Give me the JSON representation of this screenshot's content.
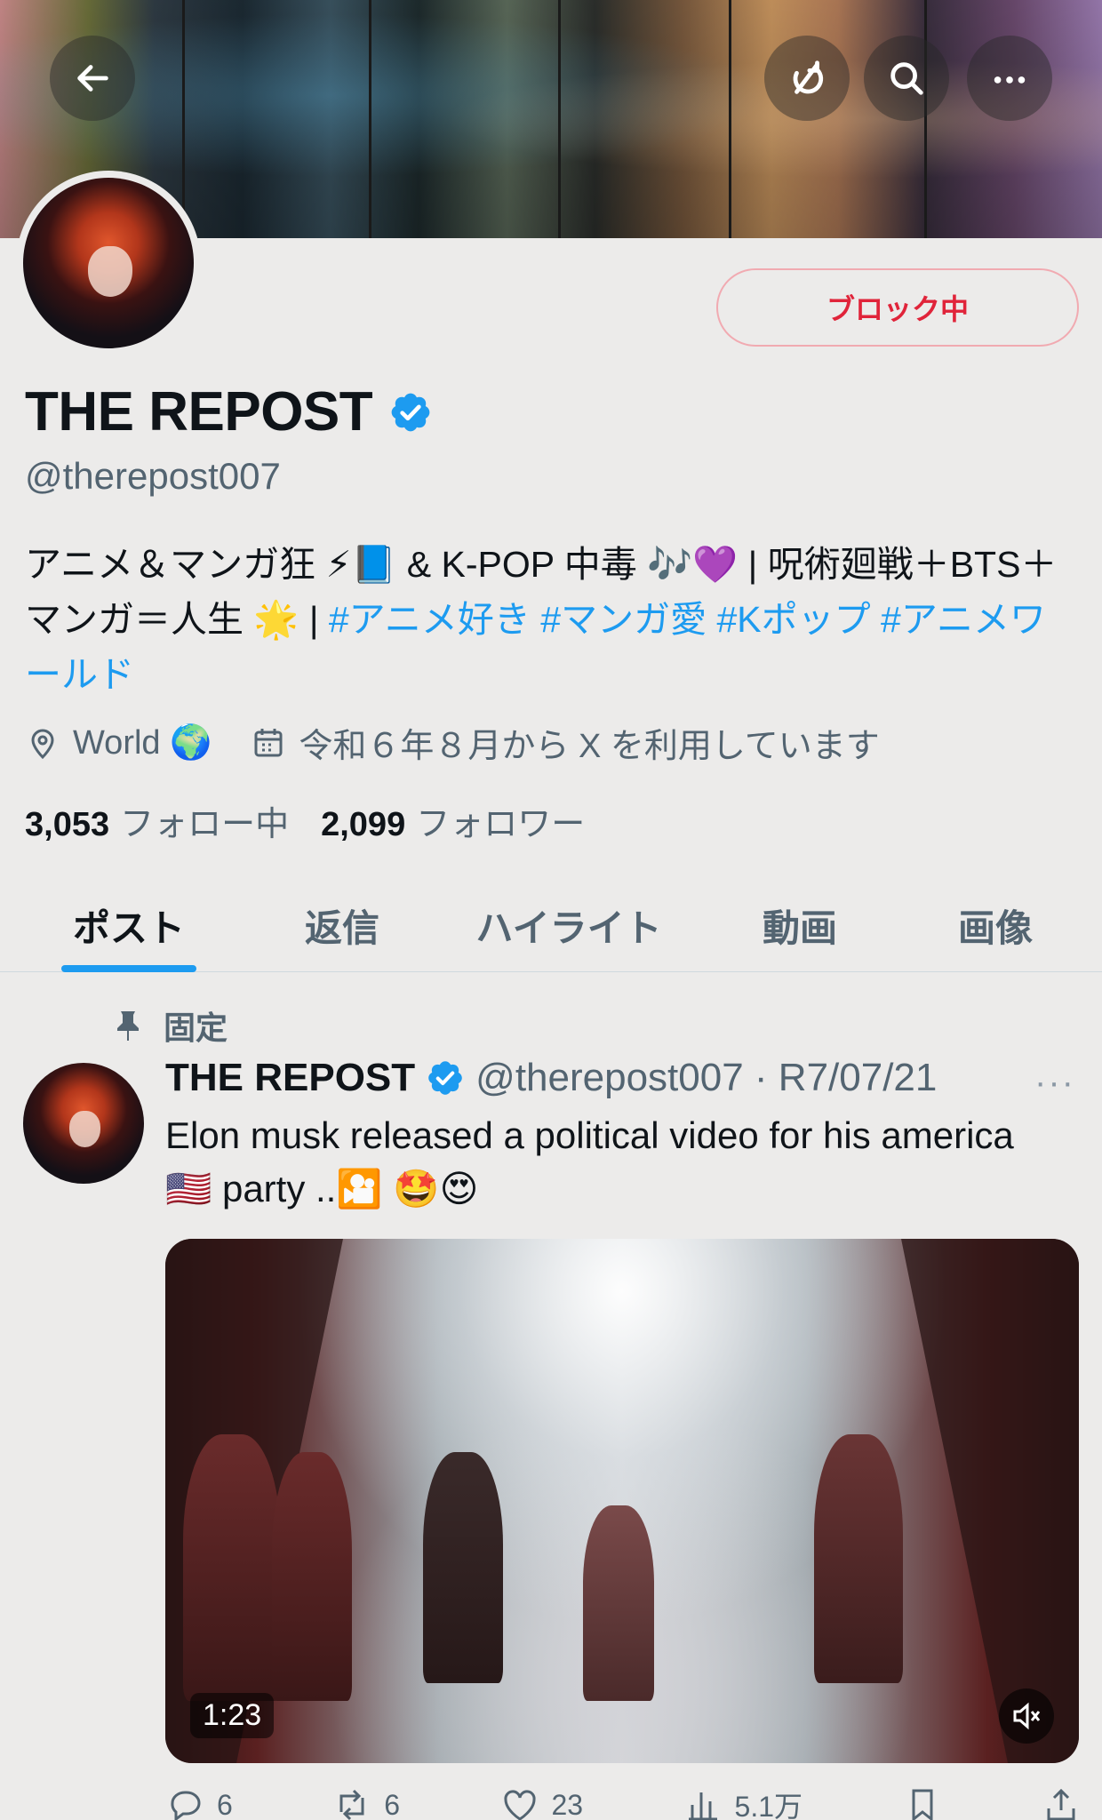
{
  "header": {
    "back_icon": "arrow-left-icon",
    "actions": [
      "refresh-icon",
      "search-icon",
      "more-icon"
    ]
  },
  "profile": {
    "block_label": "ブロック中",
    "name": "THE REPOST",
    "handle": "@therepost007",
    "bio_parts": {
      "p1": "アニメ＆マンガ狂 ⚡📘 & K-POP 中毒 🎶💜 | 呪術廻戦＋BTS＋マンガ＝人生 🌟 | ",
      "tag1": "#アニメ好き",
      "tag2": "#マンガ愛",
      "tag3": "#Kポップ",
      "tag4": "#アニメワールド"
    },
    "location": "World 🌍",
    "joined": "令和６年８月から X を利用しています",
    "following_count": "3,053",
    "following_label": "フォロー中",
    "followers_count": "2,099",
    "followers_label": "フォロワー"
  },
  "tabs": [
    {
      "label": "ポスト"
    },
    {
      "label": "返信"
    },
    {
      "label": "ハイライト"
    },
    {
      "label": "動画"
    },
    {
      "label": "画像"
    }
  ],
  "post": {
    "pinned_label": "固定",
    "author": "THE REPOST",
    "handle_date": "@therepost007 · R7/07/21",
    "more": "···",
    "text": "Elon musk released a political video for his america 🇺🇸 party ..🎦 🤩😍",
    "video_duration": "1:23",
    "replies": "6",
    "reposts": "6",
    "likes": "23",
    "views": "5.1万"
  },
  "colors": {
    "accent": "#1d9bf0",
    "block_red": "#e0243a",
    "background": "#ecebea"
  }
}
